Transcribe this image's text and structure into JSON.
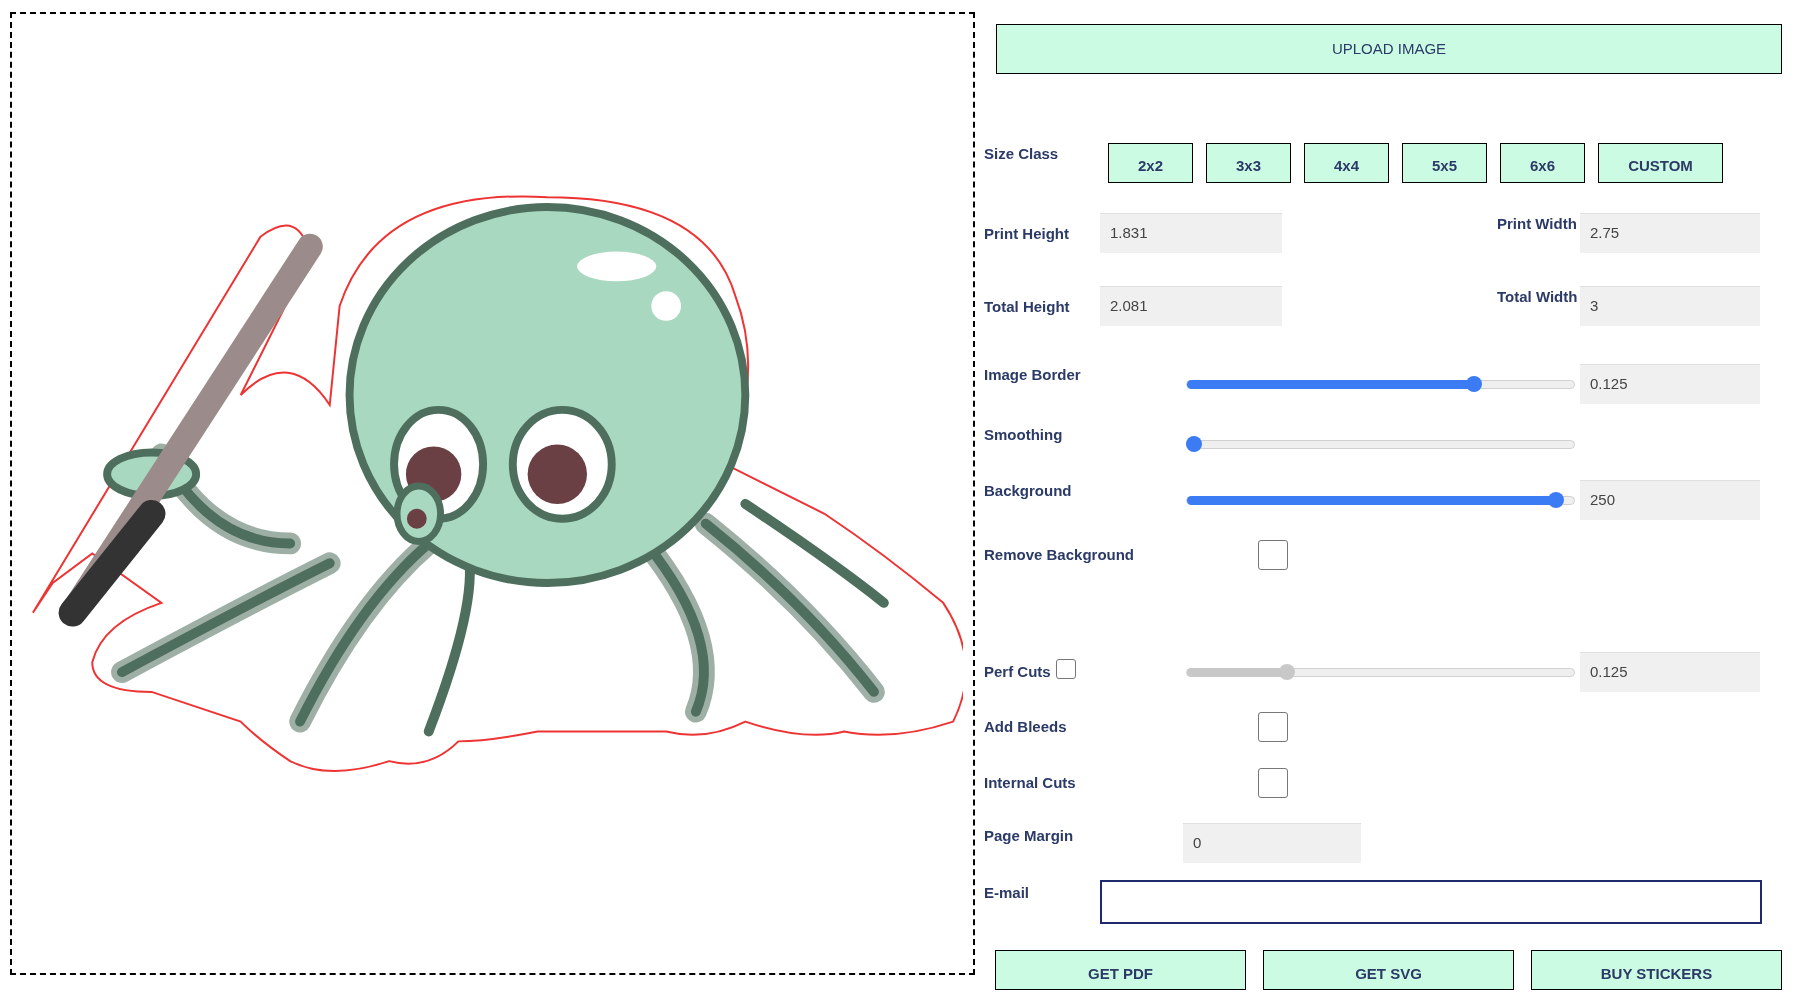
{
  "upload_button": "UPLOAD IMAGE",
  "size_class": {
    "label": "Size Class",
    "options": [
      "2x2",
      "3x3",
      "4x4",
      "5x5",
      "6x6",
      "CUSTOM"
    ]
  },
  "rows": [
    {
      "kind": "pair",
      "left": {
        "label": "Print Height",
        "value": "1.831"
      },
      "right": {
        "label": "Print Width",
        "value": "2.75"
      }
    },
    {
      "kind": "pair",
      "left": {
        "label": "Total Height",
        "value": "2.081"
      },
      "right": {
        "label": "Total Width",
        "value": "3"
      }
    },
    {
      "kind": "slider",
      "label": "Image Border",
      "level": 0.75,
      "disabled": false,
      "value": "0.125"
    },
    {
      "kind": "slider",
      "label": "Smoothing",
      "level": 0,
      "disabled": false
    },
    {
      "kind": "slider",
      "label": "Background",
      "level": 0.97,
      "disabled": false,
      "value": "250"
    },
    {
      "kind": "checkbox",
      "label": "Remove Background",
      "checked": false
    },
    {
      "kind": "perf",
      "label": "Perf Cuts",
      "checked": false,
      "level": 0.25,
      "disabled": true,
      "value": "0.125"
    },
    {
      "kind": "checkbox",
      "label": "Add Bleeds",
      "checked": false
    },
    {
      "kind": "checkbox",
      "label": "Internal Cuts",
      "checked": false
    },
    {
      "kind": "input",
      "label": "Page Margin",
      "value": "0"
    },
    {
      "kind": "email",
      "label": "E-mail"
    }
  ],
  "buttons": [
    "GET PDF",
    "GET SVG",
    "BUY STICKERS"
  ]
}
